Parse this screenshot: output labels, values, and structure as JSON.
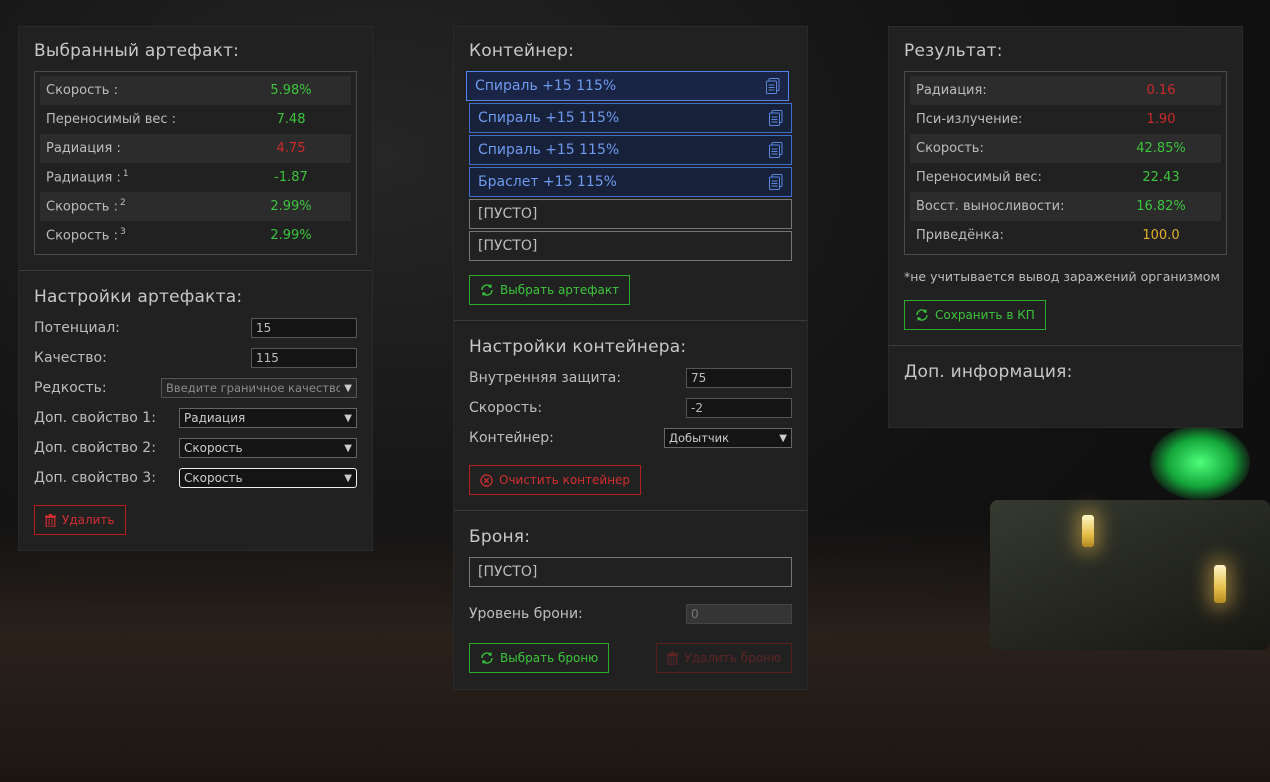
{
  "artifact": {
    "title": "Выбранный артефакт:",
    "stats": [
      {
        "label": "Скорость :",
        "sup": "",
        "value": "5.98%",
        "color": "green"
      },
      {
        "label": "Переносимый вес :",
        "sup": "",
        "value": "7.48",
        "color": "green"
      },
      {
        "label": "Радиация :",
        "sup": "",
        "value": "4.75",
        "color": "red"
      },
      {
        "label": "Радиация :",
        "sup": "1",
        "value": "-1.87",
        "color": "green"
      },
      {
        "label": "Скорость :",
        "sup": "2",
        "value": "2.99%",
        "color": "green"
      },
      {
        "label": "Скорость :",
        "sup": "3",
        "value": "2.99%",
        "color": "green"
      }
    ]
  },
  "settings": {
    "title": "Настройки артефакта:",
    "potential_label": "Потенциал:",
    "potential_value": "15",
    "quality_label": "Качество:",
    "quality_value": "115",
    "rarity_label": "Редкость:",
    "rarity_value": "Введите граничное качество",
    "extra1_label": "Доп. свойство 1:",
    "extra1_value": "Радиация",
    "extra2_label": "Доп. свойство 2:",
    "extra2_value": "Скорость",
    "extra3_label": "Доп. свойство 3:",
    "extra3_value": "Скорость",
    "delete_label": "Удалить"
  },
  "container": {
    "title": "Контейнер:",
    "slots": [
      {
        "label": "Спираль +15 115%"
      },
      {
        "label": "Спираль +15 115%"
      },
      {
        "label": "Спираль +15 115%"
      },
      {
        "label": "Браслет +15 115%"
      },
      {
        "label": "[ПУСТО]"
      },
      {
        "label": "[ПУСТО]"
      }
    ],
    "select_label": "Выбрать артефакт"
  },
  "container_settings": {
    "title": "Настройки контейнера:",
    "protection_label": "Внутренняя защита:",
    "protection_value": "75",
    "speed_label": "Скорость:",
    "speed_value": "-2",
    "container_label": "Контейнер:",
    "container_value": "Добытчик",
    "clear_label": "Очистить контейнер"
  },
  "armor": {
    "title": "Броня:",
    "slot_label": "[ПУСТО]",
    "level_label": "Уровень брони:",
    "level_value": "0",
    "select_label": "Выбрать броню",
    "delete_label": "Удалить броню"
  },
  "result": {
    "title": "Результат:",
    "stats": [
      {
        "label": "Радиация:",
        "value": "0.16",
        "color": "red"
      },
      {
        "label": "Пси-излучение:",
        "value": "1.90",
        "color": "red"
      },
      {
        "label": "Скорость:",
        "value": "42.85%",
        "color": "green"
      },
      {
        "label": "Переносимый вес:",
        "value": "22.43",
        "color": "green"
      },
      {
        "label": "Восст. выносливости:",
        "value": "16.82%",
        "color": "green"
      },
      {
        "label": "Приведёнка:",
        "value": "100.0",
        "color": "yellow"
      }
    ],
    "note": "*не учитывается вывод заражений организмом",
    "save_label": "Сохранить в КП",
    "extra_title": "Доп. информация:"
  },
  "colors": {
    "green": "#3cc43c",
    "red": "#cc2a2a",
    "yellow": "#e0b12a",
    "slot_blue": "#3d6fd1"
  }
}
